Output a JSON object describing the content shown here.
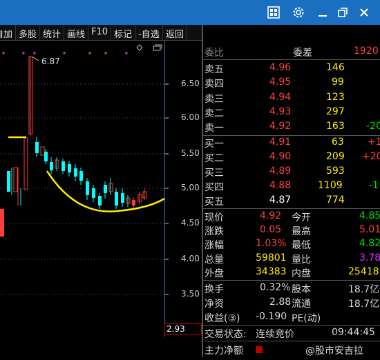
{
  "titlebar": {
    "icons": [
      "grid-icon",
      "gear-icon",
      "minimize-icon",
      "restore-icon",
      "close-icon"
    ]
  },
  "toolbar": {
    "buttons": [
      "自加",
      "多股",
      "统计",
      "画线",
      "F10",
      "标记",
      "-自选",
      "返回"
    ]
  },
  "chart": {
    "peak_label": "6.87",
    "y_ticks": [
      "6.50",
      "6.00",
      "5.50",
      "5.00",
      "4.50",
      "4.00",
      "3.50"
    ],
    "current_value": "2.93"
  },
  "quote": {
    "header": {
      "label1": "委比",
      "label2": "委差",
      "value": "1920"
    },
    "sell": [
      {
        "label": "卖五",
        "price": "4.96",
        "vol": "146",
        "chg": ""
      },
      {
        "label": "卖四",
        "price": "4.95",
        "vol": "99",
        "chg": ""
      },
      {
        "label": "卖三",
        "price": "4.94",
        "vol": "123",
        "chg": ""
      },
      {
        "label": "卖二",
        "price": "4.93",
        "vol": "297",
        "chg": ""
      },
      {
        "label": "卖一",
        "price": "4.92",
        "vol": "163",
        "chg": "-20"
      }
    ],
    "buy": [
      {
        "label": "买一",
        "price": "4.91",
        "vol": "63",
        "chg": "+1"
      },
      {
        "label": "买二",
        "price": "4.90",
        "vol": "209",
        "chg": "+20"
      },
      {
        "label": "买三",
        "price": "4.89",
        "vol": "593",
        "chg": ""
      },
      {
        "label": "买四",
        "price": "4.88",
        "vol": "1109",
        "chg": "-1"
      },
      {
        "label": "买五",
        "price": "4.87",
        "vol": "774",
        "chg": ""
      }
    ],
    "stats": [
      {
        "l1": "现价",
        "v1": "4.92",
        "l2": "今开",
        "v2": "4.85"
      },
      {
        "l1": "涨跌",
        "v1": "0.05",
        "l2": "最高",
        "v2": "5.01"
      },
      {
        "l1": "涨幅",
        "v1": "1.03%",
        "l2": "最低",
        "v2": "4.82"
      },
      {
        "l1": "总量",
        "v1": "59801",
        "l2": "量比",
        "v2": "3.78"
      },
      {
        "l1": "外盘",
        "v1": "34383",
        "l2": "内盘",
        "v2": "25418"
      }
    ],
    "fin": [
      {
        "l1": "换手",
        "v1": "0.32%",
        "l2": "股本",
        "v2": "18.7亿"
      },
      {
        "l1": "净资",
        "v1": "2.88",
        "l2": "流通",
        "v2": "18.7亿"
      },
      {
        "l1": "收益(③)",
        "v1": "-0.190",
        "l2": "PE(动)",
        "v2": ""
      }
    ],
    "trade_status_label": "交易状态:",
    "trade_status_value": "连续竞价",
    "trade_time": "09:44:45",
    "main_flow_label": "主力净额",
    "watermark": "@股市安吉拉"
  }
}
